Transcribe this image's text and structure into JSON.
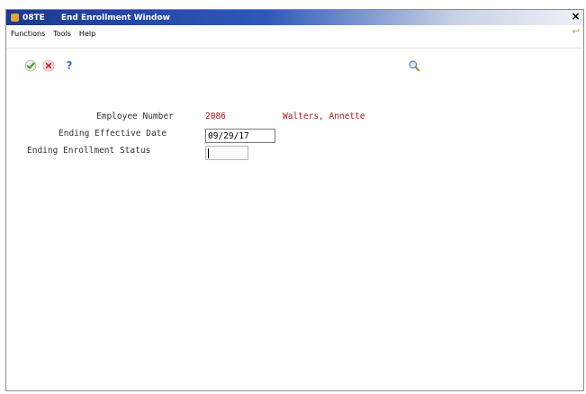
{
  "window": {
    "code": "08TE",
    "title": "End Enrollment Window",
    "close_label": "×"
  },
  "menu": {
    "items": [
      "Functions",
      "Tools",
      "Help"
    ]
  },
  "toolbar": {
    "ok_icon": "checkmark-icon",
    "cancel_icon": "x-icon",
    "help_label": "?",
    "search_icon": "magnifier-icon"
  },
  "form": {
    "employee_number_label": "Employee Number",
    "employee_number_value": "2086",
    "employee_name": "Walters, Annette",
    "ending_effective_date_label": "Ending Effective Date",
    "ending_effective_date_value": "09/29/17",
    "ending_enrollment_status_label": "Ending Enrollment Status",
    "ending_enrollment_status_value": ""
  },
  "colors": {
    "title_bar": "#1b3a8f",
    "value_text": "#a11a1a",
    "label_text": "#333333"
  }
}
